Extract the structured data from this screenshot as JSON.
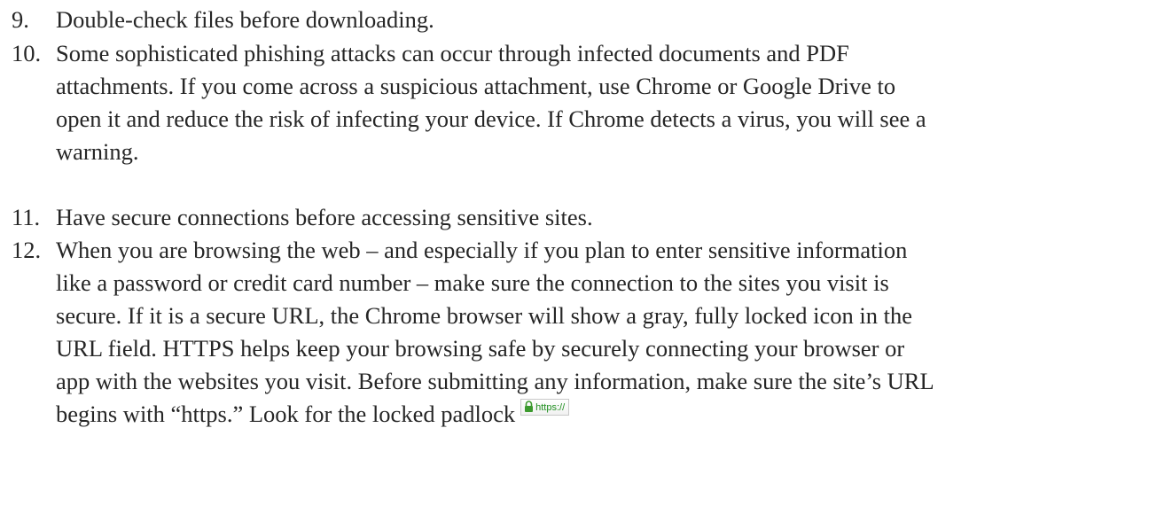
{
  "items": [
    {
      "number": "9.",
      "lines": [
        "Double-check files before downloading."
      ]
    },
    {
      "number": "10.",
      "lines": [
        "Some sophisticated phishing attacks can occur through infected documents and PDF",
        "attachments. If you come across a suspicious attachment, use Chrome or Google Drive to",
        "open it and reduce the risk of infecting your device. If Chrome detects a virus, you will see a",
        "warning."
      ]
    },
    {
      "number": "11.",
      "lines": [
        "Have secure connections before accessing sensitive sites."
      ]
    },
    {
      "number": "12.",
      "lines": [
        "When you are browsing the web – and especially if you plan to enter sensitive information",
        "like a password or credit card number – make sure the connection to the sites you visit is",
        "secure. If it is a secure URL, the Chrome browser will show a gray, fully locked icon in the",
        "URL field. HTTPS helps keep your browsing safe by securely connecting your browser or",
        "app with the websites you visit. Before submitting any information, make sure the site’s URL",
        "begins with “https.” Look for the locked padlock"
      ]
    }
  ],
  "padlock_image": {
    "text": "https://",
    "icon": "lock-icon",
    "icon_color": "#3c9a2e"
  }
}
